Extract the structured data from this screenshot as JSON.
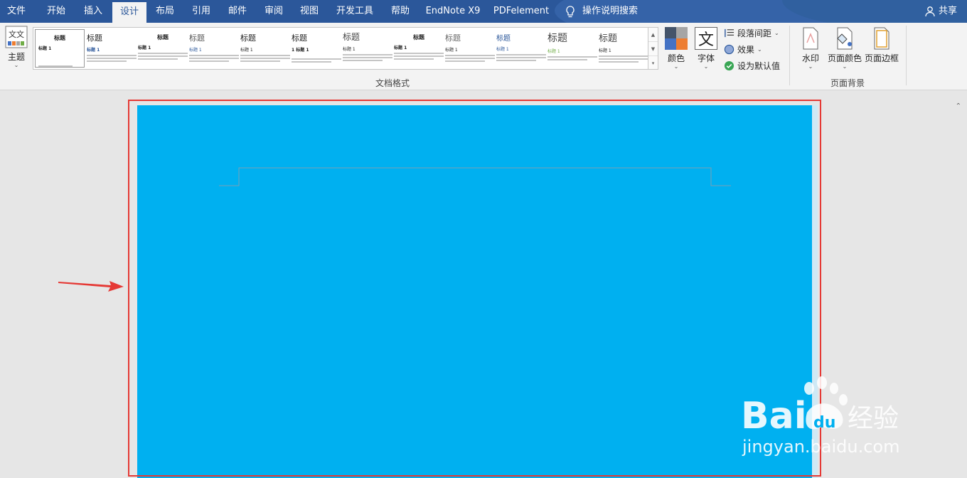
{
  "tabs": [
    {
      "label": "文件",
      "active": false
    },
    {
      "label": "开始",
      "active": false
    },
    {
      "label": "插入",
      "active": false
    },
    {
      "label": "设计",
      "active": true
    },
    {
      "label": "布局",
      "active": false
    },
    {
      "label": "引用",
      "active": false
    },
    {
      "label": "邮件",
      "active": false
    },
    {
      "label": "审阅",
      "active": false
    },
    {
      "label": "视图",
      "active": false
    },
    {
      "label": "开发工具",
      "active": false
    },
    {
      "label": "帮助",
      "active": false
    },
    {
      "label": "EndNote X9",
      "active": false
    },
    {
      "label": "PDFelement",
      "active": false
    }
  ],
  "search": {
    "label": "操作说明搜索",
    "icon": "lightbulb-icon"
  },
  "share": {
    "label": "共享",
    "icon": "person-icon"
  },
  "ribbon": {
    "theme_label": "主题",
    "theme_icon_text": "文文",
    "gallery_group_label": "文档格式",
    "styles": [
      {
        "title": "标题",
        "heading": "标题 1"
      },
      {
        "title": "标题",
        "heading": "标题 1"
      },
      {
        "title": "标题",
        "heading": "标题 1"
      },
      {
        "title": "标题",
        "heading": "标题 1"
      },
      {
        "title": "标题",
        "heading": "标题 1"
      },
      {
        "title": "标题",
        "heading": "1 标题 1"
      },
      {
        "title": "标题",
        "heading": "标题 1"
      },
      {
        "title": "标题",
        "heading": "标题 1"
      },
      {
        "title": "标题",
        "heading": "标题 1"
      },
      {
        "title": "标题",
        "heading": "标题 1"
      },
      {
        "title": "标题",
        "heading": "标题 1"
      },
      {
        "title": "标题",
        "heading": "标题 1"
      }
    ],
    "colors_label": "颜色",
    "fonts_label": "字体",
    "fonts_icon_text": "文",
    "paragraph_spacing_label": "段落间距",
    "effects_label": "效果",
    "set_default_label": "设为默认值",
    "watermark_label": "水印",
    "page_color_label": "页面颜色",
    "page_borders_label": "页面边框",
    "page_background_group_label": "页面背景"
  },
  "document": {
    "page_color": "#00b0f0"
  },
  "colors": {
    "accent": "#2b579a",
    "highlight": "#e53935"
  },
  "watermark": {
    "text_brand": "Bai",
    "text_du": "du",
    "text_cn": "经验",
    "url": "jingyan.baidu.com"
  }
}
